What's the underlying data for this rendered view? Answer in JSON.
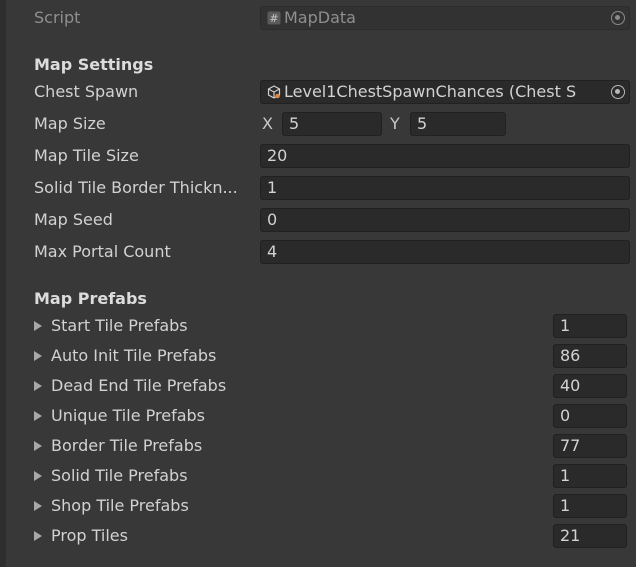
{
  "script": {
    "label": "Script",
    "value": "MapData",
    "icon": "script-hash-icon"
  },
  "map_settings": {
    "header": "Map Settings",
    "chest_spawn": {
      "label": "Chest Spawn",
      "value": "Level1ChestSpawnChances (Chest S",
      "icon": "scriptable-object-icon"
    },
    "map_size": {
      "label": "Map Size",
      "x_label": "X",
      "x": "5",
      "y_label": "Y",
      "y": "5"
    },
    "map_tile_size": {
      "label": "Map Tile Size",
      "value": "20"
    },
    "solid_tile_border": {
      "label": "Solid Tile Border Thickn...",
      "value": "1"
    },
    "map_seed": {
      "label": "Map Seed",
      "value": "0"
    },
    "max_portal_count": {
      "label": "Max Portal Count",
      "value": "4"
    }
  },
  "map_prefabs": {
    "header": "Map Prefabs",
    "items": [
      {
        "label": "Start Tile Prefabs",
        "count": "1"
      },
      {
        "label": "Auto Init Tile Prefabs",
        "count": "86"
      },
      {
        "label": "Dead End Tile Prefabs",
        "count": "40"
      },
      {
        "label": "Unique Tile Prefabs",
        "count": "0"
      },
      {
        "label": "Border Tile Prefabs",
        "count": "77"
      },
      {
        "label": "Solid Tile Prefabs",
        "count": "1"
      },
      {
        "label": "Shop Tile Prefabs",
        "count": "1"
      },
      {
        "label": "Prop Tiles",
        "count": "21"
      }
    ]
  }
}
